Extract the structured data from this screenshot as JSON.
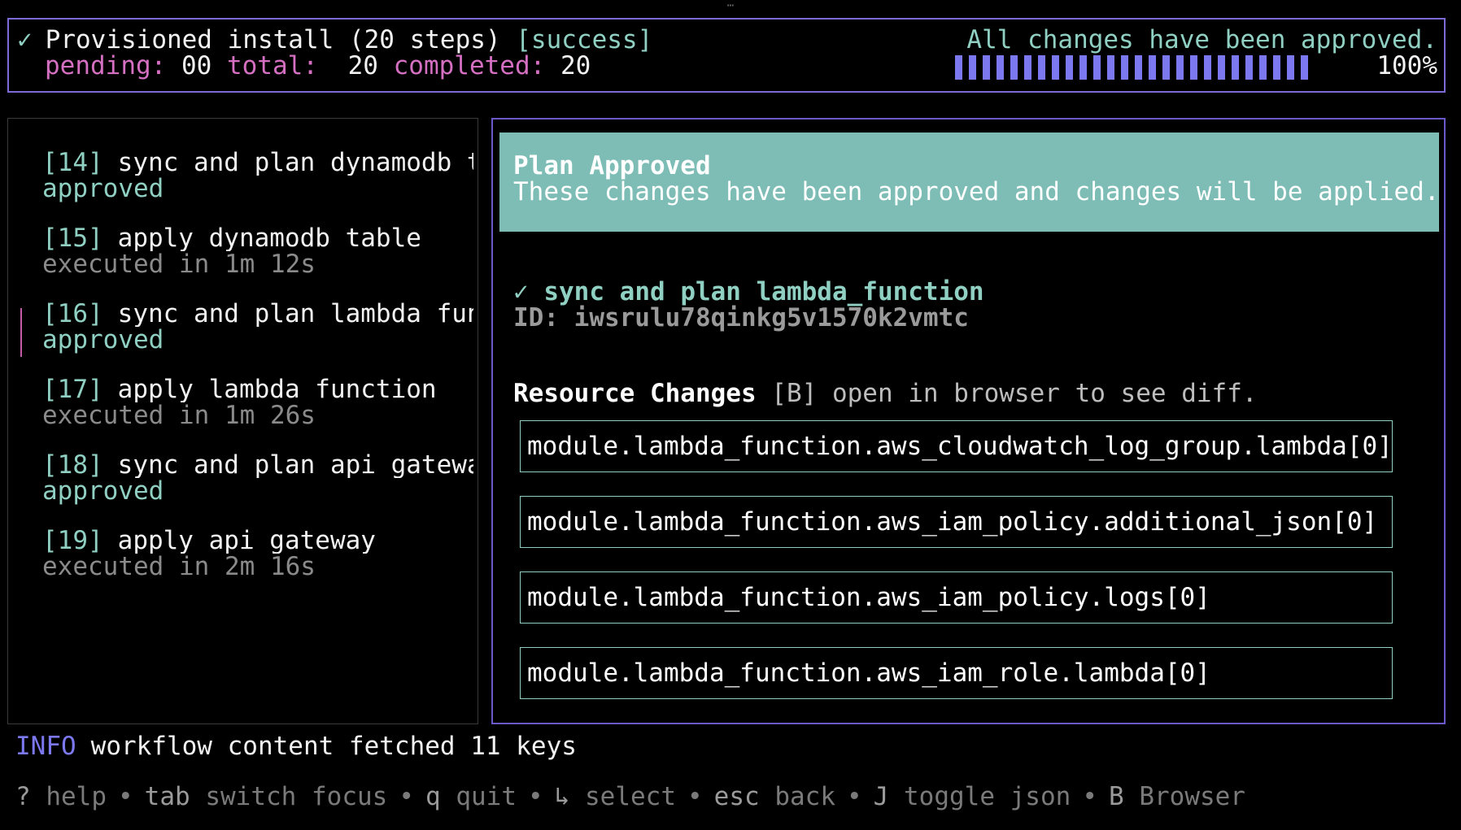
{
  "header": {
    "check_icon": "✓",
    "title": "Provisioned install (20 steps)",
    "status": "[success]",
    "pending_label": "pending:",
    "pending_value": "00",
    "total_label": "total:",
    "total_value": "20",
    "completed_label": "completed:",
    "completed_value": "20",
    "approved_message": "All changes have been approved.",
    "progress_percent": "100%",
    "progress_fraction": 1.0,
    "progress_color": "#7c78ef"
  },
  "steps": [
    {
      "num": "[14]",
      "title": "sync and plan dynamodb_t…",
      "status": "approved",
      "status_kind": "approved"
    },
    {
      "num": "[15]",
      "title": "apply dynamodb_table",
      "status": "executed in 1m 12s",
      "status_kind": "executed"
    },
    {
      "num": "[16]",
      "title": "sync and plan lambda_fun…",
      "status": "approved",
      "status_kind": "approved",
      "selected": true
    },
    {
      "num": "[17]",
      "title": "apply lambda_function",
      "status": "executed in 1m 26s",
      "status_kind": "executed"
    },
    {
      "num": "[18]",
      "title": "sync and plan api_gateway",
      "status": "approved",
      "status_kind": "approved"
    },
    {
      "num": "[19]",
      "title": "apply api_gateway",
      "status": "executed in 2m 16s",
      "status_kind": "executed"
    }
  ],
  "detail": {
    "banner_title": "Plan Approved",
    "banner_text": "These changes have been approved and changes will be applied.",
    "plan_check": "✓",
    "plan_name": "sync and plan lambda_function",
    "plan_id": "ID: iwsrulu78qinkg5v1570k2vmtc",
    "resource_title": "Resource Changes",
    "resource_hint": "[B] open in browser to see diff.",
    "resources": [
      "module.lambda_function.aws_cloudwatch_log_group.lambda[0]",
      "module.lambda_function.aws_iam_policy.additional_json[0]",
      "module.lambda_function.aws_iam_policy.logs[0]",
      "module.lambda_function.aws_iam_role.lambda[0]"
    ]
  },
  "log": {
    "level": "INFO",
    "message": "workflow content fetched 11 keys"
  },
  "help_bar": {
    "items": [
      {
        "key": "?",
        "action": "help"
      },
      {
        "key": "tab",
        "action": "switch focus"
      },
      {
        "key": "q",
        "action": "quit"
      },
      {
        "key": "↳",
        "action": "select"
      },
      {
        "key": "esc",
        "action": "back"
      },
      {
        "key": "J",
        "action": "toggle json"
      },
      {
        "key": "B",
        "action": "Browser"
      }
    ],
    "separator": "•"
  },
  "colors": {
    "accent_teal": "#8fd0c3",
    "accent_pink": "#d46fc2",
    "accent_purple": "#7c78ef",
    "banner_bg": "#7dbdb5"
  }
}
